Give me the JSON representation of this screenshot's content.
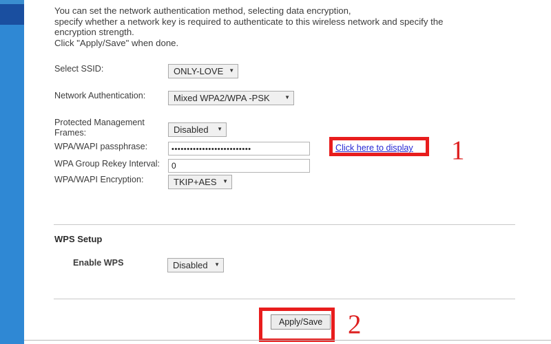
{
  "page": {
    "intro_lines": [
      "You can set the network authentication method, selecting data encryption,",
      "specify whether a network key is required to authenticate to this wireless network and specify the",
      "encryption strength.",
      "Click \"Apply/Save\" when done."
    ]
  },
  "form": {
    "select_ssid": {
      "label": "Select SSID:",
      "value": "ONLY-LOVE",
      "caret": "▼"
    },
    "network_authentication": {
      "label": "Network Authentication:",
      "value": "Mixed WPA2/WPA -PSK",
      "caret": "▼"
    },
    "protected_management_frames": {
      "label": "Protected Management\nFrames:",
      "value": "Disabled",
      "caret": "▼"
    },
    "wpa_passphrase": {
      "label": "WPA/WAPI passphrase:",
      "value": "••••••••••••••••••••••••••",
      "reveal_link": "Click here to display"
    },
    "wpa_group_rekey_interval": {
      "label": "WPA Group Rekey Interval:",
      "value": "0"
    },
    "wpa_encryption": {
      "label": "WPA/WAPI Encryption:",
      "value": "TKIP+AES",
      "caret": "▼"
    }
  },
  "wps": {
    "section_title": "WPS Setup",
    "enable_wps": {
      "label_plain": "Enable ",
      "label_bold": "WPS",
      "value": "Disabled",
      "caret": "▼"
    }
  },
  "actions": {
    "apply_save": "Apply/Save"
  },
  "annotations": {
    "step_one": "1",
    "step_two": "2",
    "highlight_color": "#e81d1d"
  }
}
